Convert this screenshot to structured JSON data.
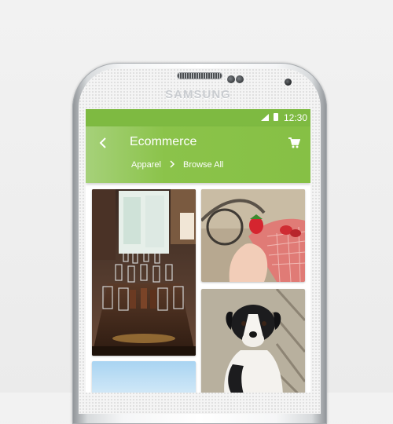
{
  "device": {
    "brand": "SAMSUNG"
  },
  "status_bar": {
    "time": "12:30",
    "icons": [
      "signal-icon",
      "battery-icon"
    ],
    "color": "#7eba41"
  },
  "app_bar": {
    "title": "Ecommerce",
    "back_icon": "chevron-left-icon",
    "cart_icon": "shopping-cart-icon",
    "breadcrumb": [
      "Apparel",
      "Browse All"
    ],
    "separator_icon": "chevron-right-icon",
    "color": "#8bc34a"
  },
  "gallery": [
    {
      "subject": "restaurant-table-with-glasses"
    },
    {
      "subject": "hand-holding-strawberry-at-bike-basket"
    },
    {
      "subject": "black-and-white-puppy"
    },
    {
      "subject": "sky-partial"
    }
  ]
}
